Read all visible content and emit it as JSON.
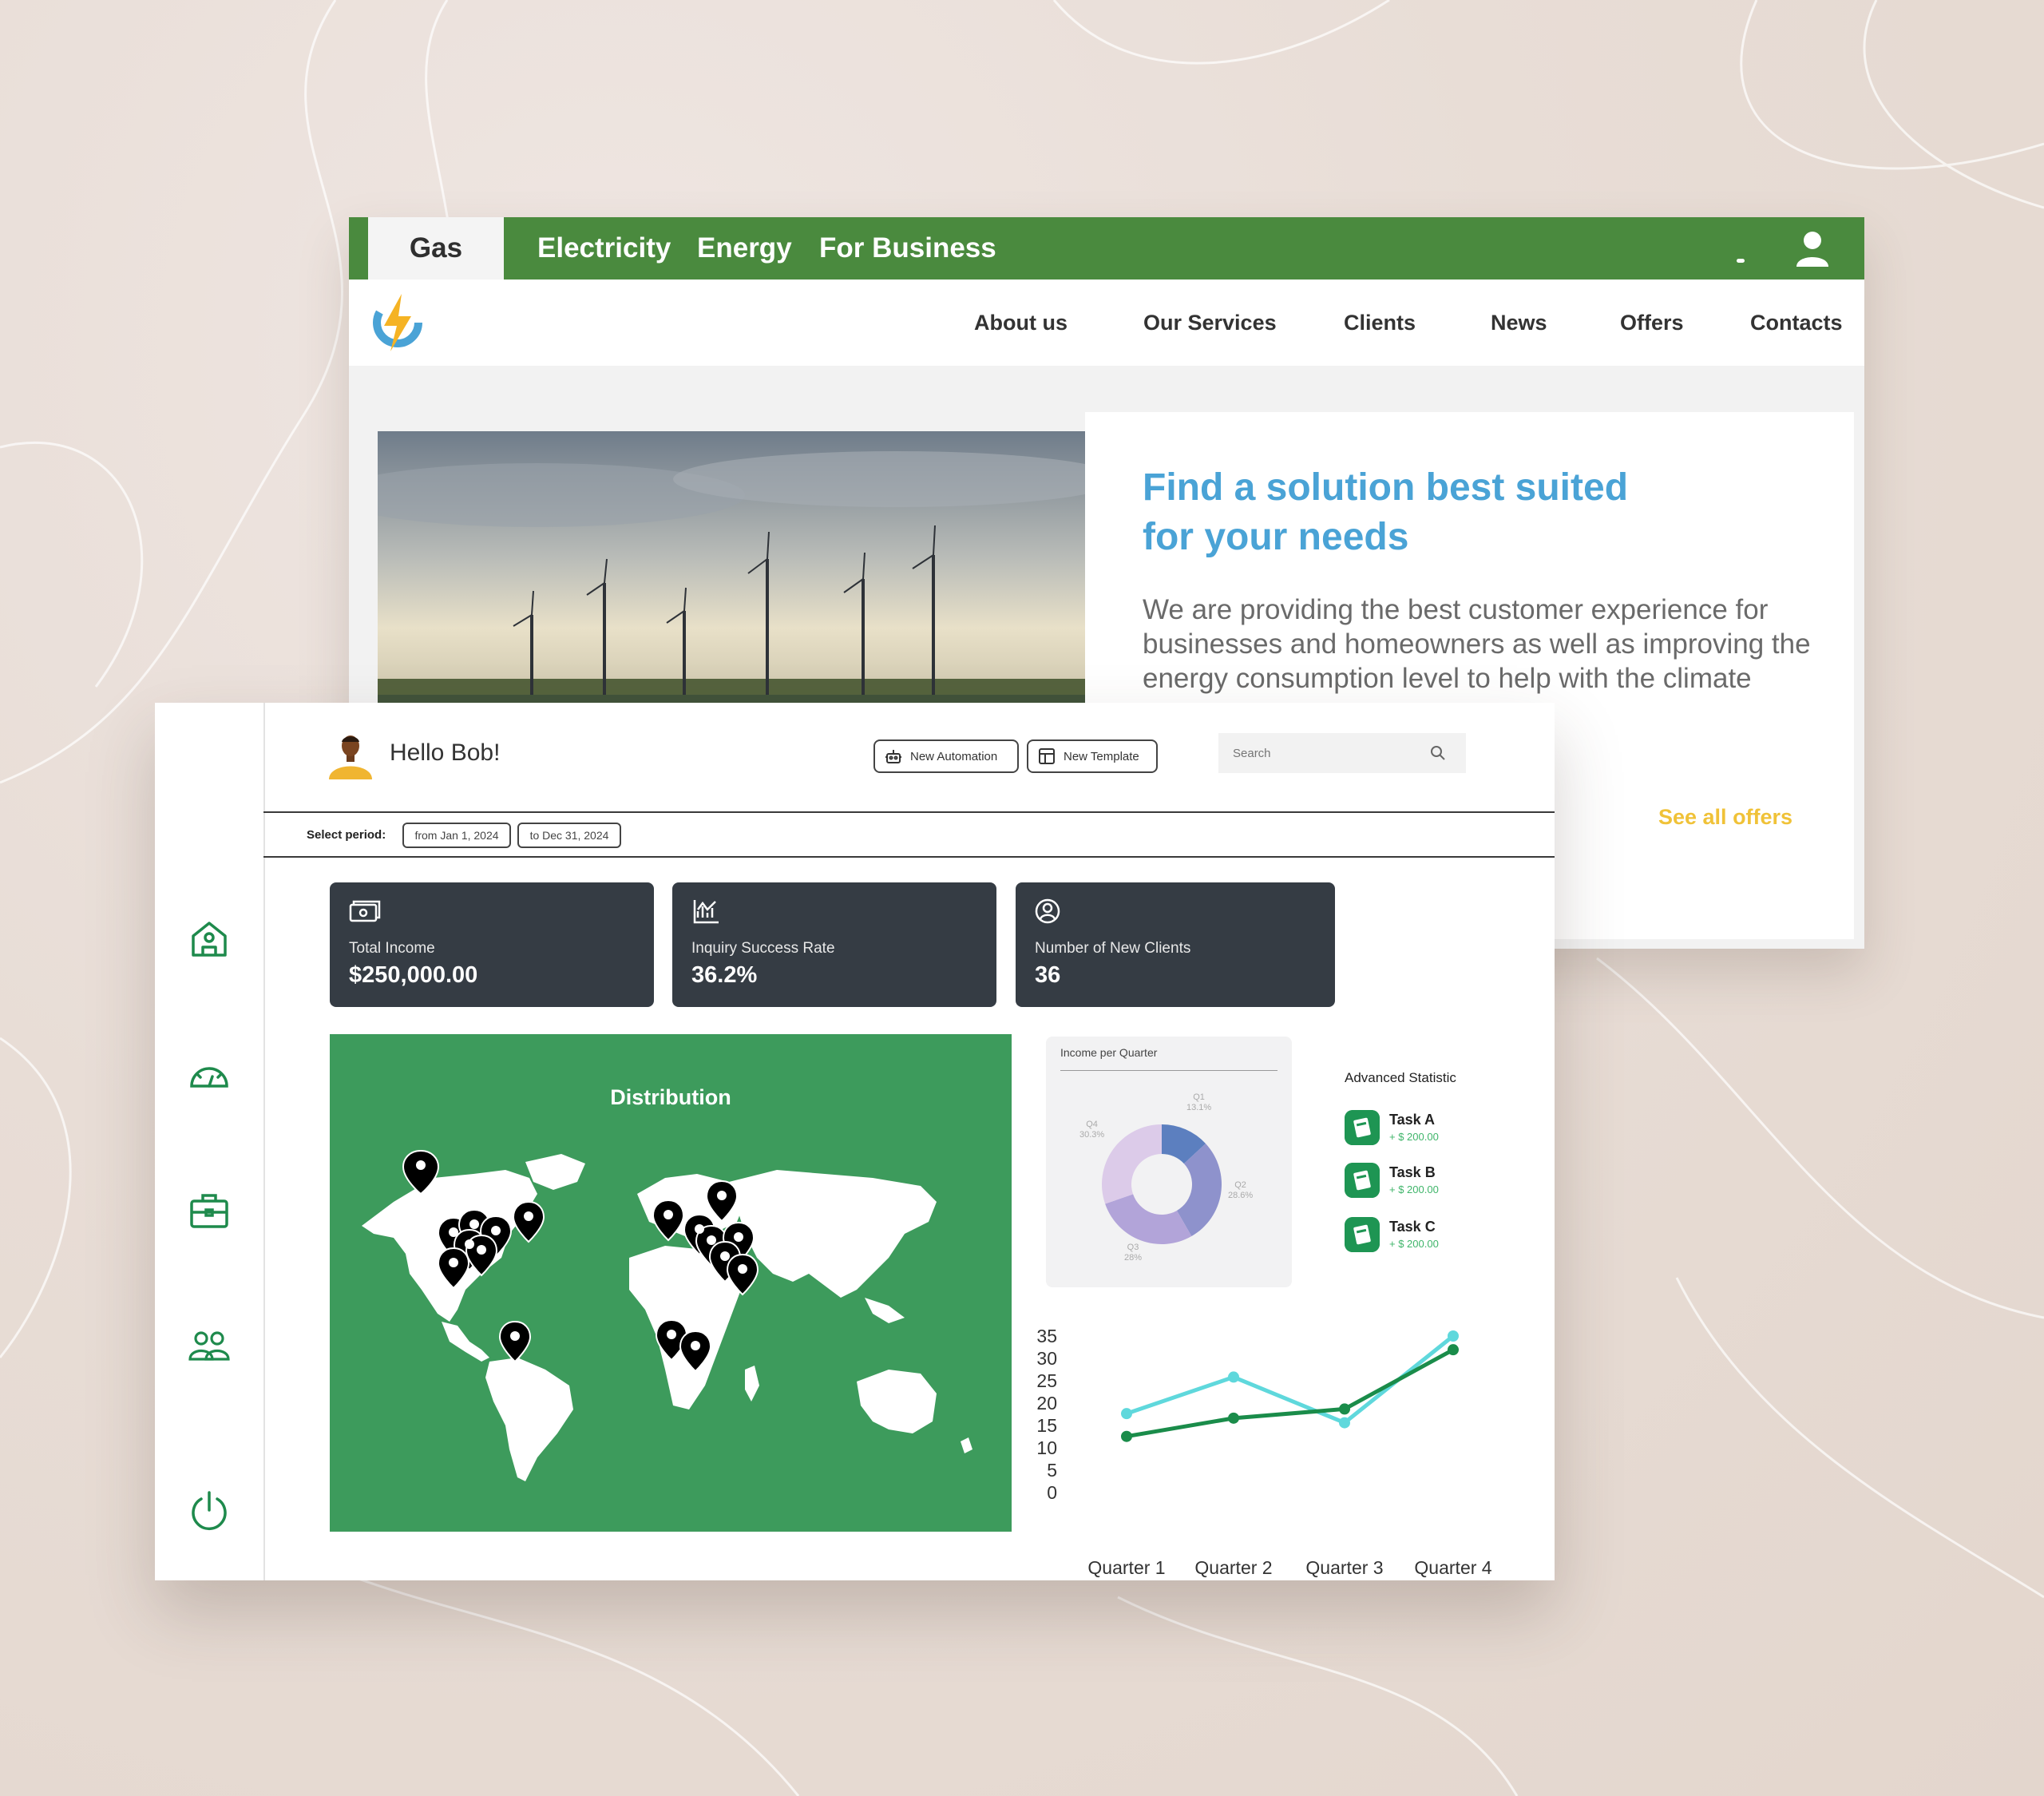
{
  "website": {
    "tabs": [
      "Gas",
      "Electricity",
      "Energy",
      "For Business"
    ],
    "nav": [
      "About us",
      "Our Services",
      "Clients",
      "News",
      "Offers",
      "Contacts"
    ],
    "hero_title": "Find a solution best suited for your needs",
    "hero_text": "We are providing the best customer experience for businesses and homeowners as well as improving the energy consumption level to help with the climate",
    "see_all": "See all offers",
    "colors": {
      "brand_green": "#4a8a3e",
      "title_blue": "#4aa3d6",
      "link_yellow": "#f0c238"
    }
  },
  "dashboard": {
    "greeting": "Hello Bob!",
    "buttons": {
      "new_automation": "New Automation",
      "new_template": "New Template"
    },
    "search_placeholder": "Search",
    "period": {
      "label": "Select period:",
      "from": "from Jan 1, 2024",
      "to": "to Dec 31, 2024"
    },
    "kpis": [
      {
        "label": "Total Income",
        "value": "$250,000.00",
        "icon": "money-icon"
      },
      {
        "label": "Inquiry Success Rate",
        "value": "36.2%",
        "icon": "chart-icon"
      },
      {
        "label": "Number of New Clients",
        "value": "36",
        "icon": "user-circle-icon"
      }
    ],
    "sidebar_icons": [
      "home-icon",
      "speedometer-icon",
      "briefcase-icon",
      "users-icon",
      "power-icon"
    ],
    "map_title": "Distribution",
    "donut": {
      "title": "Income per Quarter",
      "slices": [
        {
          "label": "Q1",
          "value": "13.1%"
        },
        {
          "label": "Q2",
          "value": "28.6%"
        },
        {
          "label": "Q3",
          "value": "28%"
        },
        {
          "label": "Q4",
          "value": "30.3%"
        }
      ]
    },
    "advanced": {
      "title": "Advanced Statistic",
      "tasks": [
        {
          "name": "Task A",
          "amount": "+ $ 200.00"
        },
        {
          "name": "Task B",
          "amount": "+ $ 200.00"
        },
        {
          "name": "Task C",
          "amount": "+ $ 200.00"
        }
      ]
    },
    "colors": {
      "kpi_bg": "#353c44",
      "map_green": "#3d9b5c",
      "accent_green": "#1e9553"
    }
  },
  "chart_data": [
    {
      "type": "pie",
      "title": "Income per Quarter",
      "categories": [
        "Q1",
        "Q2",
        "Q3",
        "Q4"
      ],
      "values": [
        13.1,
        28.6,
        28,
        30.3
      ],
      "colors": [
        "#5c7fbf",
        "#8e92cc",
        "#b2a4d9",
        "#dccbe9"
      ]
    },
    {
      "type": "line",
      "categories": [
        "Quarter 1",
        "Quarter 2",
        "Quarter 3",
        "Quarter 4"
      ],
      "ylim": [
        0,
        35
      ],
      "yticks": [
        "35",
        "30",
        "25",
        "20",
        "15",
        "10",
        "5",
        "0"
      ],
      "series": [
        {
          "values": [
            18,
            26,
            16,
            35
          ],
          "color": "#5fd8dc"
        },
        {
          "values": [
            13,
            17,
            19,
            32
          ],
          "color": "#1a8c4a"
        }
      ]
    }
  ]
}
